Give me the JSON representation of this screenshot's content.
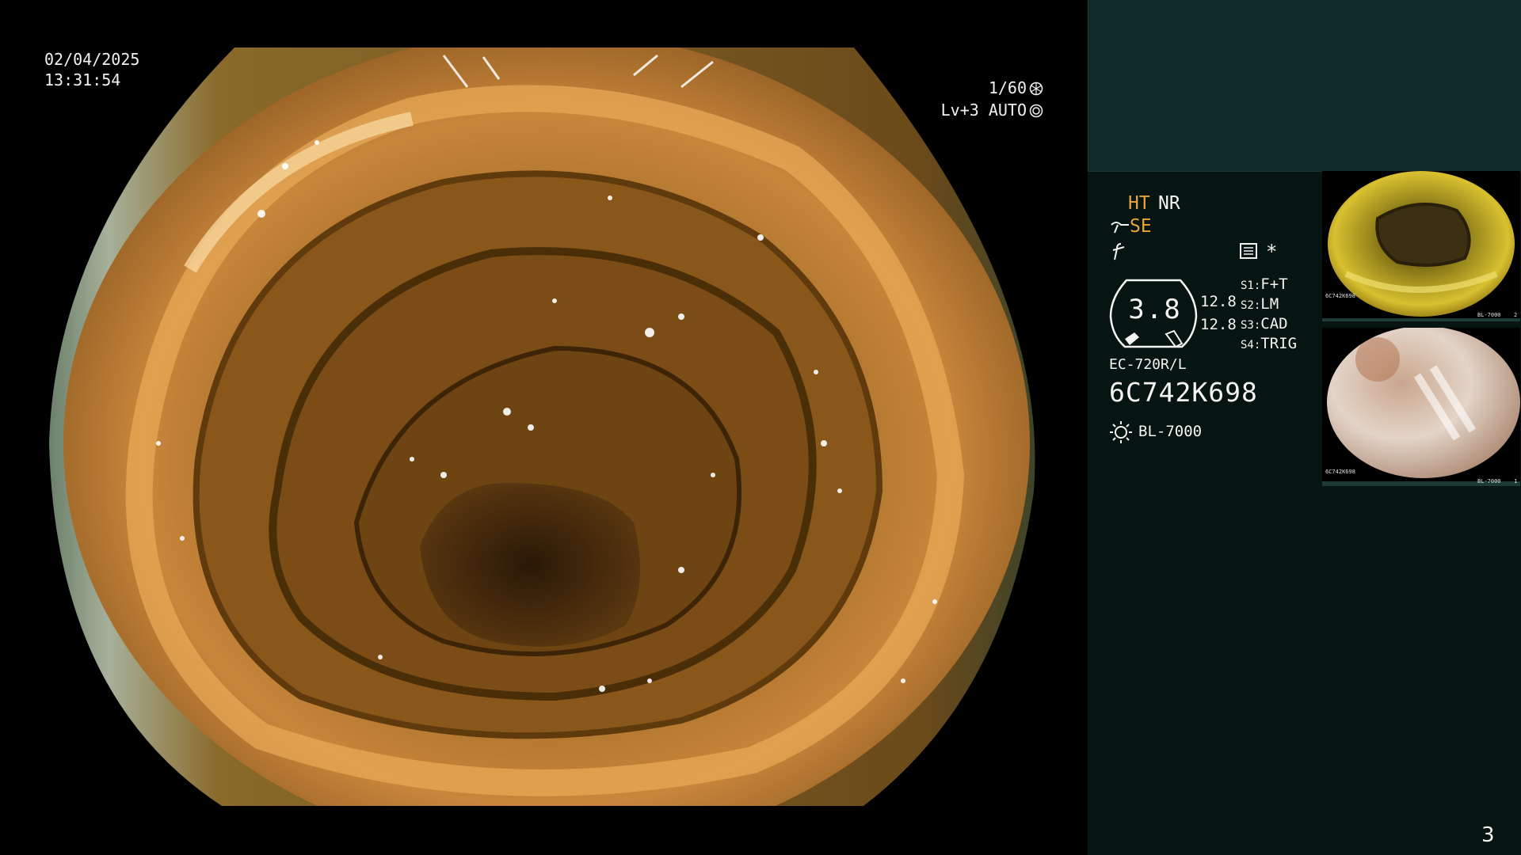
{
  "overlay": {
    "date": "02/04/2025",
    "time": "13:31:54",
    "shutter": "1/60",
    "shutter_icon": "shutter-icon",
    "level": "Lv+3 AUTO",
    "auto_icon": "auto-iris-icon"
  },
  "panel": {
    "ht": "HT",
    "nr": "NR",
    "se": "SE",
    "se_icon": "enhance-icon",
    "f_icon": "freeze-icon",
    "memo_icon": "memo-icon",
    "star": "*",
    "zoom_value": "3.8",
    "value_1": "12.8",
    "value_2": "12.8",
    "switches": [
      {
        "key": "S1:",
        "value": "F+T"
      },
      {
        "key": "S2:",
        "value": "LM"
      },
      {
        "key": "S3:",
        "value": "CAD"
      },
      {
        "key": "S4:",
        "value": "TRIG"
      }
    ],
    "scope_model": "EC-720R/L",
    "serial": "6C742K698",
    "lamp_icon": "light-source-icon",
    "light_source": "BL-7000",
    "page_number": "3"
  },
  "thumbnails": [
    {
      "index": "2",
      "serial": "6C742K698",
      "light": "BL-7000"
    },
    {
      "index": "1",
      "serial": "6C742K698",
      "light": "BL-7000"
    }
  ],
  "colors": {
    "accent_orange": "#e9a53a",
    "panel_bg": "#061412",
    "top_band": "#0e2a27"
  }
}
